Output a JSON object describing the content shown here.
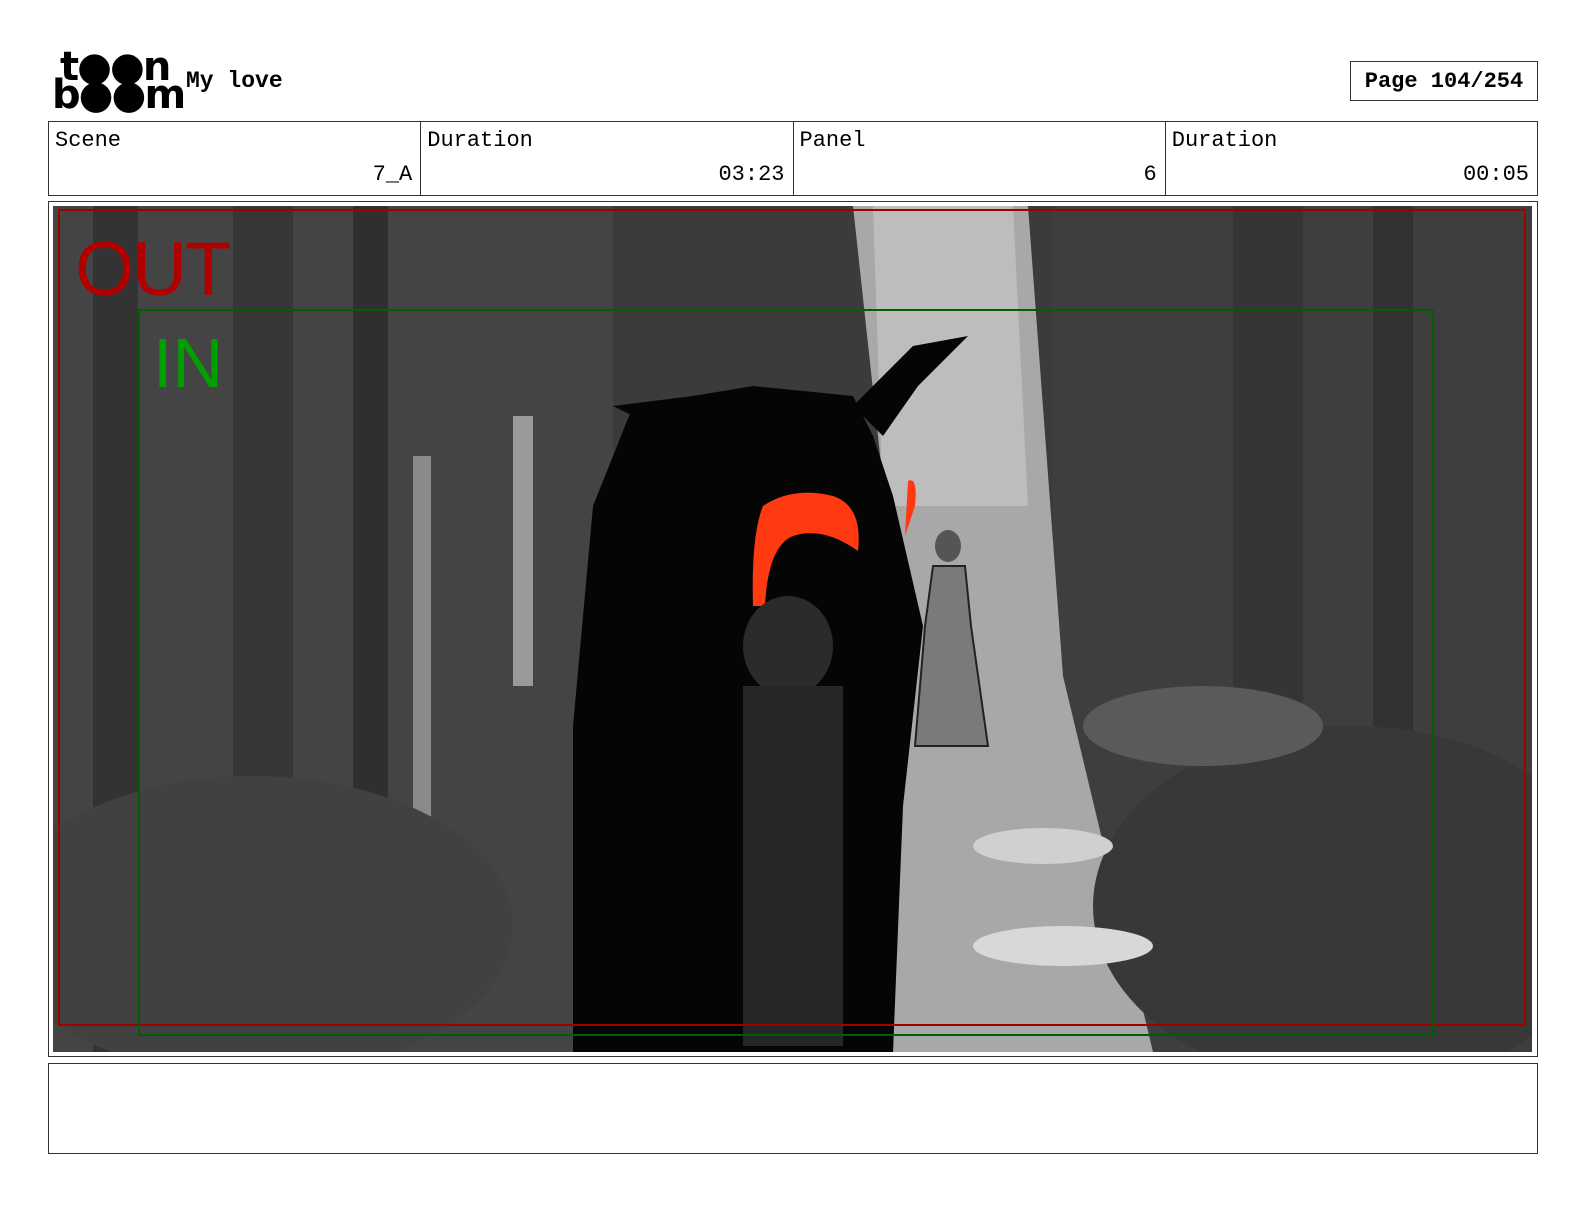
{
  "header": {
    "logo_line1": "t●●n",
    "logo_line2": "b●●m",
    "project_title": "My love",
    "page_label": "Page 104/254"
  },
  "info": {
    "scene_label": "Scene",
    "scene_value": "7_A",
    "scene_duration_label": "Duration",
    "scene_duration_value": "03:23",
    "panel_label": "Panel",
    "panel_value": "6",
    "panel_duration_label": "Duration",
    "panel_duration_value": "00:05"
  },
  "frame": {
    "out_label": "OUT",
    "in_label": "IN",
    "out_color": "#b00000",
    "in_color": "#00a000"
  },
  "notes": {
    "text": ""
  }
}
